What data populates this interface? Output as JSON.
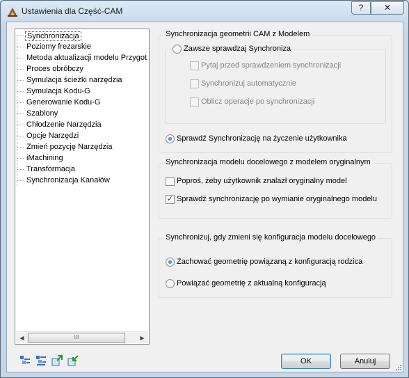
{
  "window": {
    "title": "Ustawienia dla Część-CAM",
    "help_label": "?",
    "close_label": "✕"
  },
  "tree": {
    "items": [
      "Synchronizacja",
      "Poziomy frezarskie",
      "Metoda aktualizacji modelu Przygot",
      "Proces obróbczy",
      "Symulacja ścieżki narzędzia",
      "Symulacja Kodu-G",
      "Generowanie Kodu-G",
      "Szablony",
      "Chłodzenie Narzędzia",
      "Opcje Narzędzi",
      "Zmień pozycję Narzędzia",
      "iMachining",
      "Transformacja",
      "Synchronizacja Kanałów"
    ],
    "selected": "Synchronizacja",
    "scroll_thumb": "III"
  },
  "groups": {
    "geom": {
      "title": "Synchronizacja geometrii CAM z Modelem",
      "always": "Zawsze sprawdzaj Synchroniza",
      "ask": "Pytaj przed sprawdzeniem synchronizacji",
      "auto": "Synchronizuj automatycznie",
      "calc": "Oblicz operacje po synchronizacji",
      "on_demand": "Sprawdź Synchronizację na życzenie użytkownika"
    },
    "model": {
      "title": "Synchronizacja modelu docelowego z modelem oryginalnym",
      "ask_user": "Poproś, żeby użytkownik znalazł oryginalny model",
      "check_after": "Sprawdź synchronizację po wymianie oryginalnego modelu"
    },
    "config": {
      "title": "Synchronizuj, gdy zmieni się konfiguracja modelu docelowego",
      "keep": "Zachować geometrię powiązaną z konfiguracją rodzica",
      "link": "Powiązać geometrię z aktualną konfiguracją"
    }
  },
  "buttons": {
    "ok": "OK",
    "cancel": "Anuluj"
  },
  "states": {
    "always_checked": false,
    "on_demand_checked": true,
    "ask_user_checked": false,
    "check_after_checked": true,
    "keep_checked": true,
    "link_checked": false
  },
  "icons": [
    "tree-collapse-icon",
    "tree-expand-icon",
    "export-icon",
    "import-icon"
  ],
  "colors": {
    "client_bg": "#f0f0f0",
    "frame": "#c6d7ea",
    "radio_dot": "#1c5aa8"
  }
}
